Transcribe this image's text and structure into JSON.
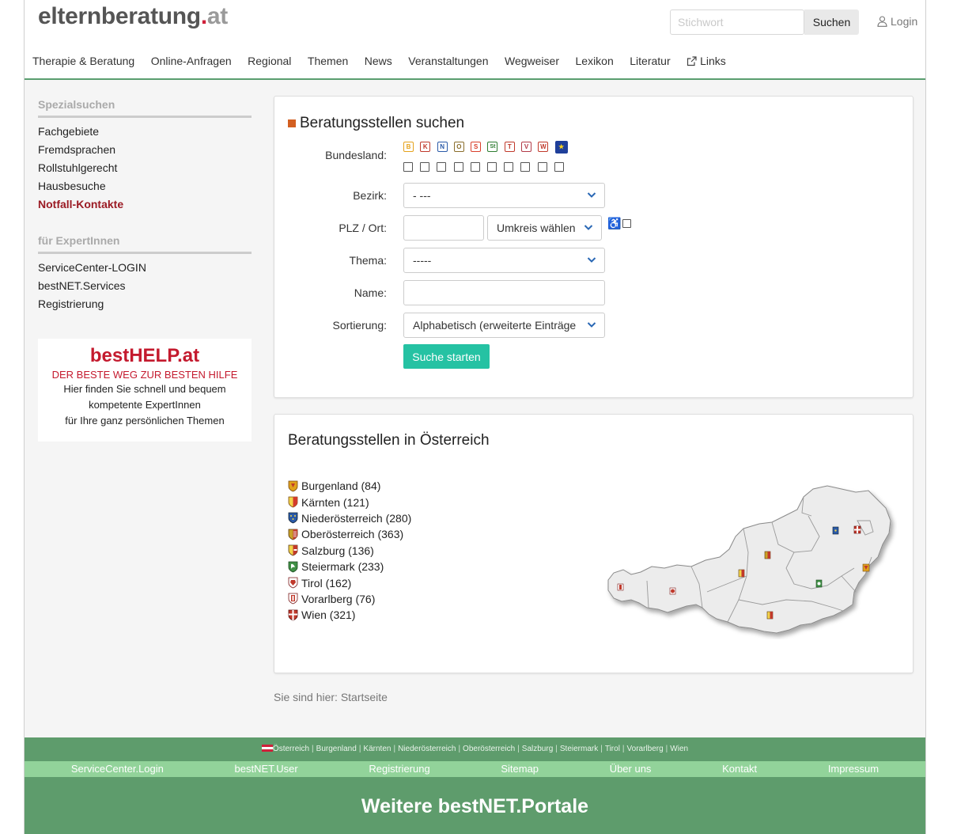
{
  "brand": {
    "name_main": "elternberatung",
    "name_dot": ".",
    "name_tld": "at",
    "colors": {
      "accent": "#5a9e6f",
      "logo_dot": "#d0203a",
      "cta": "#25c2a3",
      "sidebar_alert": "#9b1b24",
      "title_square": "#d35f21"
    }
  },
  "header": {
    "search": {
      "placeholder": "Stichwort",
      "value": "",
      "button": "Suchen"
    },
    "login": {
      "label": "Login",
      "icon": "user-icon"
    }
  },
  "nav": [
    {
      "label": "Therapie & Beratung"
    },
    {
      "label": "Online-Anfragen"
    },
    {
      "label": "Regional"
    },
    {
      "label": "Themen"
    },
    {
      "label": "News"
    },
    {
      "label": "Veranstaltungen"
    },
    {
      "label": "Wegweiser"
    },
    {
      "label": "Lexikon"
    },
    {
      "label": "Literatur"
    },
    {
      "label": "Links",
      "icon": "external-link-icon"
    }
  ],
  "sidebar": {
    "special_heading": "Spezialsuchen",
    "special_items": [
      "Fachgebiete",
      "Fremdsprachen",
      "Rollstuhlgerecht",
      "Hausbesuche",
      "Notfall-Kontakte"
    ],
    "expert_heading": "für ExpertInnen",
    "expert_items": [
      "ServiceCenter-LOGIN",
      "bestNET.Services",
      "Registrierung"
    ],
    "ad": {
      "logo": "bestHELP.at",
      "tagline": "DER BESTE WEG ZUR BESTEN HILFE",
      "line1": "Hier finden Sie schnell und bequem",
      "line2": "kompetente ExpertInnen",
      "line3": "für Ihre ganz persönlichen Themen"
    }
  },
  "search_form": {
    "title": "Beratungsstellen suchen",
    "labels": {
      "state": "Bundesland:",
      "district": "Bezirk:",
      "zip": "PLZ / Ort:",
      "topic": "Thema:",
      "name": "Name:",
      "sort": "Sortierung:"
    },
    "state_buttons": [
      {
        "code": "B",
        "color": "#e5a21c"
      },
      {
        "code": "K",
        "color": "#c0392b"
      },
      {
        "code": "N",
        "color": "#2a5aa8"
      },
      {
        "code": "O",
        "color": "#8a6d2b"
      },
      {
        "code": "S",
        "color": "#d9402c"
      },
      {
        "code": "St",
        "color": "#2e7d32"
      },
      {
        "code": "T",
        "color": "#c0392b"
      },
      {
        "code": "V",
        "color": "#b23a48"
      },
      {
        "code": "W",
        "color": "#c0392b"
      },
      {
        "code": "EU",
        "color": "#1f3f9a"
      }
    ],
    "district_value": "-  ---",
    "zip_value": "",
    "radius_value": "Umkreis wählen",
    "wheelchair_icon": "wheelchair-icon",
    "topic_value": "-----",
    "name_value": "",
    "sort_value": "Alphabetisch (erweiterte Einträge",
    "submit": "Suche starten"
  },
  "regions": {
    "title": "Beratungsstellen in Österreich",
    "items": [
      {
        "name": "Burgenland (84)",
        "crest": "#e0a21d"
      },
      {
        "name": "Kärnten (121)",
        "crest": "#d33b2c"
      },
      {
        "name": "Niederösterreich (280)",
        "crest": "#2a5aa8"
      },
      {
        "name": "Oberösterreich (363)",
        "crest": "#c9a227"
      },
      {
        "name": "Salzburg (136)",
        "crest": "#c0392b"
      },
      {
        "name": "Steiermark (233)",
        "crest": "#3f8f45"
      },
      {
        "name": "Tirol (162)",
        "crest": "#c0392b"
      },
      {
        "name": "Vorarlberg (76)",
        "crest": "#c0392b"
      },
      {
        "name": "Wien (321)",
        "crest": "#c0392b"
      }
    ]
  },
  "breadcrumb": "Sie sind hier: Startseite",
  "footer": {
    "states_line": [
      "Österreich",
      "Burgenland",
      "Kärnten",
      "Niederösterreich",
      "Oberösterreich",
      "Salzburg",
      "Steiermark",
      "Tirol",
      "Vorarlberg",
      "Wien"
    ],
    "links": [
      "ServiceCenter.Login",
      "bestNET.User",
      "Registrierung",
      "Sitemap",
      "Über uns",
      "Kontakt",
      "Impressum"
    ],
    "portals_title": "Weitere bestNET.Portale"
  }
}
